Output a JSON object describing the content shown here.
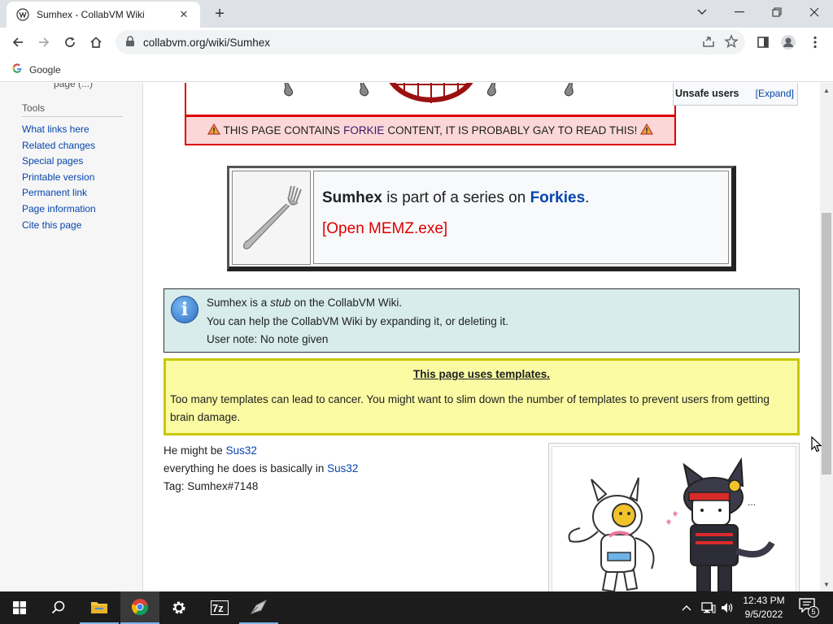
{
  "browser": {
    "tab_title": "Sumhex - CollabVM Wiki",
    "tab_close": "✕",
    "new_tab": "+",
    "url": "collabvm.org/wiki/Sumhex",
    "bookmark_google": "Google"
  },
  "sidebar": {
    "partial_text": "page (...)",
    "tools_heading": "Tools",
    "links": [
      "What links here",
      "Related changes",
      "Special pages",
      "Printable version",
      "Permanent link",
      "Page information",
      "Cite this page"
    ]
  },
  "forkie_warning": {
    "prefix": "THIS PAGE CONTAINS",
    "link": "FORKIE",
    "suffix": "CONTENT, IT IS PROBABLY GAY TO READ THIS!"
  },
  "unsafe_users": {
    "title": "Unsafe users",
    "toggle": "[Expand]"
  },
  "series_box": {
    "subject": "Sumhex",
    "middle": "is part of a series on",
    "series_link": "Forkies",
    "period": ".",
    "action": "[Open MEMZ.exe]"
  },
  "stub": {
    "line1_before": "Sumhex is a",
    "line1_em": "stub",
    "line1_after": "on the CollabVM Wiki.",
    "line2": "You can help the CollabVM Wiki by expanding it, or deleting it.",
    "line3": "User note: No note given",
    "icon_glyph": "i"
  },
  "templates": {
    "title": "This page uses templates.",
    "body": "Too many templates can lead to cancer. You might want to slim down the number of templates to prevent users from getting brain damage."
  },
  "article": {
    "line1_text": "He might be",
    "line1_link": "Sus32",
    "line2_text": "everything he does is basically in",
    "line2_link": "Sus32",
    "line3": "Tag: Sumhex#7148"
  },
  "taskbar": {
    "time": "12:43 PM",
    "date": "9/5/2022",
    "notifications": "5"
  },
  "colors": {
    "link": "#0645ad",
    "warning_red": "#dd0000",
    "stub_bg": "#d7eceb",
    "template_bg": "#fbfba3"
  }
}
